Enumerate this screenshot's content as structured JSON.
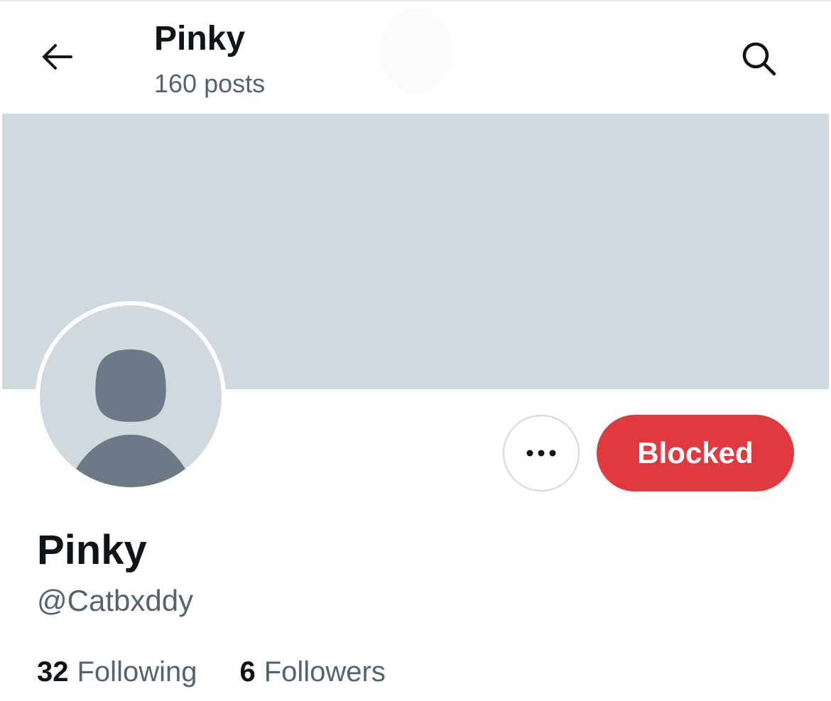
{
  "header": {
    "title": "Pinky",
    "subtitle": "160 posts",
    "back_icon": "arrow-left-icon",
    "search_icon": "search-icon"
  },
  "profile": {
    "display_name": "Pinky",
    "handle": "@Catbxddy",
    "avatar_icon": "default-avatar-icon"
  },
  "actions": {
    "more_icon": "more-horizontal-icon",
    "blocked_label": "Blocked",
    "blocked_color": "#e0393e"
  },
  "stats": {
    "following_count": "32",
    "following_label": "Following",
    "followers_count": "6",
    "followers_label": "Followers"
  },
  "colors": {
    "text_primary": "#0f1419",
    "text_secondary": "#536471",
    "banner": "#cfd9de",
    "avatar_silhouette": "#6b7a86"
  }
}
